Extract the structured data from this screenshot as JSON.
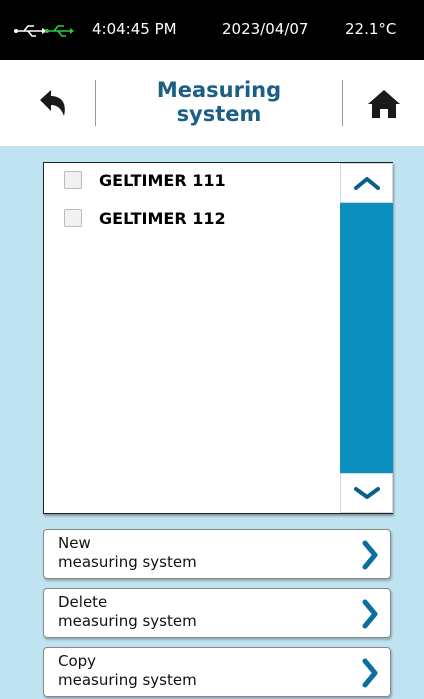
{
  "status": {
    "time": "4:04:45 PM",
    "date": "2023/04/07",
    "temperature": "22.1°C",
    "usb_icon": "usb-icon"
  },
  "header": {
    "title_line1": "Measuring",
    "title_line2": "system",
    "back_icon": "back-arrow-icon",
    "home_icon": "home-icon"
  },
  "list": {
    "items": [
      {
        "label": "GELTIMER 111",
        "checked": false
      },
      {
        "label": "GELTIMER 112",
        "checked": false
      }
    ]
  },
  "actions": [
    {
      "line1": "New",
      "line2": "measuring system"
    },
    {
      "line1": "Delete",
      "line2": "measuring system"
    },
    {
      "line1": "Copy",
      "line2": "measuring system"
    }
  ],
  "colors": {
    "accent": "#0a8fbf",
    "title": "#1b5e86",
    "background": "#bfe3f0",
    "status_bar": "#000000"
  }
}
